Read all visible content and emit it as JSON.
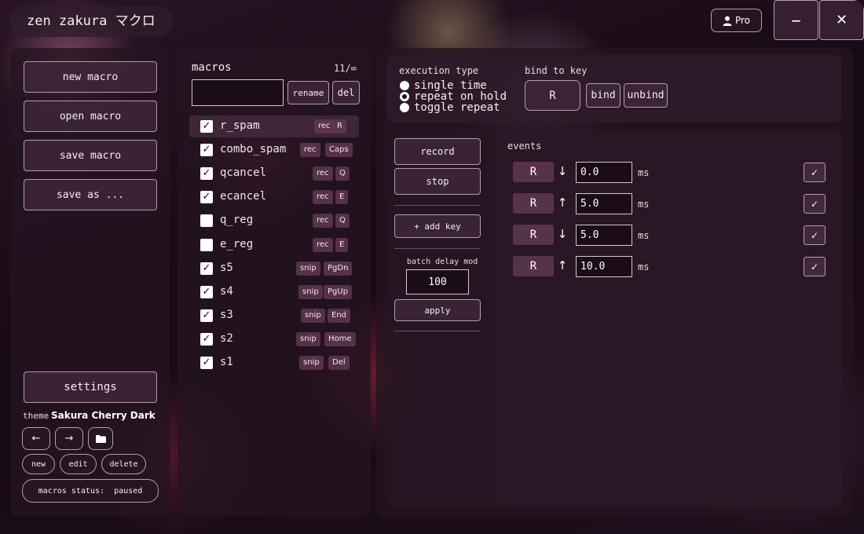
{
  "app": {
    "title": "zen zakura マクロ",
    "pro_label": "Pro",
    "minimize_glyph": "−",
    "close_glyph": "✕"
  },
  "sidebar": {
    "buttons": [
      "new macro",
      "open macro",
      "save macro",
      "save as ..."
    ],
    "settings_label": "settings",
    "theme_label": "theme",
    "theme_name": "Sakura Cherry Dark",
    "prev_glyph": "←",
    "next_glyph": "→",
    "theme_actions": [
      "new",
      "edit",
      "delete"
    ],
    "status_text": "macros status:  paused"
  },
  "macros": {
    "heading": "macros",
    "count": "11/∞",
    "name_value": "",
    "rename_label": "rename",
    "del_label": "del",
    "items": [
      {
        "name": "r_spam",
        "checked": true,
        "tag": "rec",
        "key": "R",
        "active": true
      },
      {
        "name": "combo_spam",
        "checked": true,
        "tag": "rec",
        "key": "Caps",
        "active": false
      },
      {
        "name": "qcancel",
        "checked": true,
        "tag": "rec",
        "key": "Q",
        "active": false
      },
      {
        "name": "ecancel",
        "checked": true,
        "tag": "rec",
        "key": "E",
        "active": false
      },
      {
        "name": "q_reg",
        "checked": false,
        "tag": "rec",
        "key": "Q",
        "active": false
      },
      {
        "name": "e_reg",
        "checked": false,
        "tag": "rec",
        "key": "E",
        "active": false
      },
      {
        "name": "s5",
        "checked": true,
        "tag": "snip",
        "key": "PgDn",
        "active": false
      },
      {
        "name": "s4",
        "checked": true,
        "tag": "snip",
        "key": "PgUp",
        "active": false
      },
      {
        "name": "s3",
        "checked": true,
        "tag": "snip",
        "key": "End",
        "active": false
      },
      {
        "name": "s2",
        "checked": true,
        "tag": "snip",
        "key": "Home",
        "active": false
      },
      {
        "name": "s1",
        "checked": true,
        "tag": "snip",
        "key": "Del",
        "active": false
      }
    ]
  },
  "execution": {
    "heading": "execution type",
    "options": [
      "single time",
      "repeat on hold",
      "toggle repeat"
    ],
    "selected": 1
  },
  "bind": {
    "heading": "bind to key",
    "key": "R",
    "bind_label": "bind",
    "unbind_label": "unbind"
  },
  "controls": {
    "record_label": "record",
    "stop_label": "stop",
    "add_key_label": "+ add key",
    "batch_label": "batch delay mod",
    "batch_value": "100",
    "apply_label": "apply"
  },
  "events": {
    "heading": "events",
    "unit": "ms",
    "check_glyph": "✓",
    "items": [
      {
        "key": "R",
        "direction": "↓",
        "delay": "0.0"
      },
      {
        "key": "R",
        "direction": "↑",
        "delay": "5.0"
      },
      {
        "key": "R",
        "direction": "↓",
        "delay": "5.0"
      },
      {
        "key": "R",
        "direction": "↑",
        "delay": "10.0"
      }
    ]
  }
}
